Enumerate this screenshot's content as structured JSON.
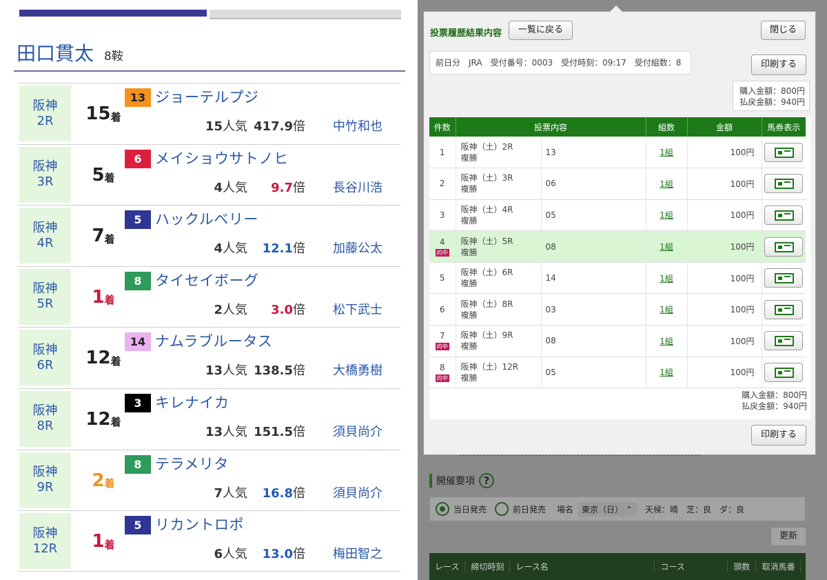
{
  "jockey_profile": {
    "name": "田口貫太",
    "rides": "8鞍",
    "races": [
      {
        "venue": "阪神",
        "race": "2R",
        "finish": "15",
        "finish_unit": "着",
        "finish_class": "normal",
        "gate": "13",
        "gate_bg": "#f5921e",
        "gate_fg": "#222222",
        "horse": "ジョーテルプジ",
        "pop_num": "15",
        "pop_unit": "人気",
        "odds_num": "417.9",
        "odds_unit": "倍",
        "odds_class": "black",
        "jockey": "中竹和也"
      },
      {
        "venue": "阪神",
        "race": "3R",
        "finish": "5",
        "finish_unit": "着",
        "finish_class": "normal",
        "gate": "6",
        "gate_bg": "#dc1f3c",
        "gate_fg": "#ffffff",
        "horse": "メイショウサトノヒ",
        "pop_num": "4",
        "pop_unit": "人気",
        "odds_num": "9.7",
        "odds_unit": "倍",
        "odds_class": "red",
        "jockey": "長谷川浩"
      },
      {
        "venue": "阪神",
        "race": "4R",
        "finish": "7",
        "finish_unit": "着",
        "finish_class": "normal",
        "gate": "5",
        "gate_bg": "#2e3592",
        "gate_fg": "#ffffff",
        "horse": "ハックルベリー",
        "pop_num": "4",
        "pop_unit": "人気",
        "odds_num": "12.1",
        "odds_unit": "倍",
        "odds_class": "blue",
        "jockey": "加藤公太"
      },
      {
        "venue": "阪神",
        "race": "5R",
        "finish": "1",
        "finish_unit": "着",
        "finish_class": "win",
        "gate": "8",
        "gate_bg": "#2f9a5a",
        "gate_fg": "#ffffff",
        "horse": "タイセイボーグ",
        "pop_num": "2",
        "pop_unit": "人気",
        "odds_num": "3.0",
        "odds_unit": "倍",
        "odds_class": "red",
        "jockey": "松下武士"
      },
      {
        "venue": "阪神",
        "race": "6R",
        "finish": "12",
        "finish_unit": "着",
        "finish_class": "normal",
        "gate": "14",
        "gate_bg": "#eab3ef",
        "gate_fg": "#222222",
        "horse": "ナムラブルータス",
        "pop_num": "13",
        "pop_unit": "人気",
        "odds_num": "138.5",
        "odds_unit": "倍",
        "odds_class": "black",
        "jockey": "大橋勇樹"
      },
      {
        "venue": "阪神",
        "race": "8R",
        "finish": "12",
        "finish_unit": "着",
        "finish_class": "normal",
        "gate": "3",
        "gate_bg": "#000000",
        "gate_fg": "#ffffff",
        "horse": "キレナイカ",
        "pop_num": "13",
        "pop_unit": "人気",
        "odds_num": "151.5",
        "odds_unit": "倍",
        "odds_class": "black",
        "jockey": "須貝尚介"
      },
      {
        "venue": "阪神",
        "race": "9R",
        "finish": "2",
        "finish_unit": "着",
        "finish_class": "second",
        "gate": "8",
        "gate_bg": "#2f9a5a",
        "gate_fg": "#ffffff",
        "horse": "テラメリタ",
        "pop_num": "7",
        "pop_unit": "人気",
        "odds_num": "16.8",
        "odds_unit": "倍",
        "odds_class": "blue",
        "jockey": "須貝尚介"
      },
      {
        "venue": "阪神",
        "race": "12R",
        "finish": "1",
        "finish_unit": "着",
        "finish_class": "win",
        "gate": "5",
        "gate_bg": "#2e3592",
        "gate_fg": "#ffffff",
        "horse": "リカントロポ",
        "pop_num": "6",
        "pop_unit": "人気",
        "odds_num": "13.0",
        "odds_unit": "倍",
        "odds_class": "blue",
        "jockey": "梅田智之"
      }
    ]
  },
  "modal": {
    "title": "投票履歴結果内容",
    "back_button": "一覧に戻る",
    "close_button": "閉じる",
    "print_button": "印刷する",
    "info": "前日分　JRA　受付番号：0003　受付時刻：09:17　受付組数：8",
    "purchase_total": "購入金額：800円",
    "refund_total": "払戻金額：940円",
    "columns": [
      "件数",
      "投票内容",
      "組数",
      "金額",
      "馬券表示"
    ],
    "rows": [
      {
        "no": "1",
        "race": "阪神（土）2R",
        "type": "複勝",
        "selection": "13",
        "count": "1組",
        "amount": "100円",
        "hit": false,
        "hit_label": ""
      },
      {
        "no": "2",
        "race": "阪神（土）3R",
        "type": "複勝",
        "selection": "06",
        "count": "1組",
        "amount": "100円",
        "hit": false,
        "hit_label": ""
      },
      {
        "no": "3",
        "race": "阪神（土）4R",
        "type": "複勝",
        "selection": "05",
        "count": "1組",
        "amount": "100円",
        "hit": false,
        "hit_label": ""
      },
      {
        "no": "4",
        "race": "阪神（土）5R",
        "type": "複勝",
        "selection": "08",
        "count": "1組",
        "amount": "100円",
        "hit": true,
        "hit_label": "的中"
      },
      {
        "no": "5",
        "race": "阪神（土）6R",
        "type": "複勝",
        "selection": "14",
        "count": "1組",
        "amount": "100円",
        "hit": false,
        "hit_label": ""
      },
      {
        "no": "6",
        "race": "阪神（土）8R",
        "type": "複勝",
        "selection": "03",
        "count": "1組",
        "amount": "100円",
        "hit": false,
        "hit_label": ""
      },
      {
        "no": "7",
        "race": "阪神（土）9R",
        "type": "複勝",
        "selection": "08",
        "count": "1組",
        "amount": "100円",
        "hit": false,
        "hit_label": "的中"
      },
      {
        "no": "8",
        "race": "阪神（土）12R",
        "type": "複勝",
        "selection": "05",
        "count": "1組",
        "amount": "100円",
        "hit": false,
        "hit_label": "的中"
      }
    ]
  },
  "background_page": {
    "section_title": "開催要項",
    "help_icon": "?",
    "radio_same_day": "当日発売",
    "radio_previous_day": "前日発売",
    "venue_label": "場名",
    "venue_value": "東京（日）",
    "weather": "天候：晴　芝：良　ダ：良",
    "refresh_button": "更新",
    "table_headers": [
      "レース",
      "締切時刻",
      "レース名",
      "コース",
      "頭数",
      "取消馬番"
    ]
  }
}
